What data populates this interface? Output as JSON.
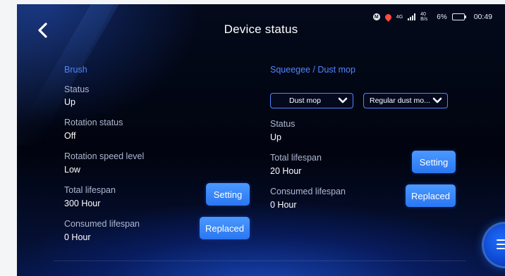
{
  "header": {
    "title": "Device status"
  },
  "status_bar": {
    "network_type": "4G",
    "speed_value": "40",
    "speed_unit": "B/s",
    "battery_percent": "6%",
    "time": "00:49"
  },
  "brush": {
    "section_title": "Brush",
    "status_label": "Status",
    "status_value": "Up",
    "rotation_status_label": "Rotation status",
    "rotation_status_value": "Off",
    "rotation_speed_label": "Rotation speed level",
    "rotation_speed_value": "Low",
    "total_lifespan_label": "Total lifespan",
    "total_lifespan_value": "300 Hour",
    "consumed_lifespan_label": "Consumed lifespan",
    "consumed_lifespan_value": "0 Hour",
    "setting_label": "Setting",
    "replaced_label": "Replaced"
  },
  "squeegee": {
    "section_title": "Squeegee / Dust mop",
    "type_select_value": "Dust mop",
    "mode_select_value": "Regular dust mo...",
    "status_label": "Status",
    "status_value": "Up",
    "total_lifespan_label": "Total lifespan",
    "total_lifespan_value": "20 Hour",
    "consumed_lifespan_label": "Consumed lifespan",
    "consumed_lifespan_value": "0 Hour",
    "setting_label": "Setting",
    "replaced_label": "Replaced"
  },
  "icons": {
    "back": "chevron-left-icon",
    "dropdown": "chevron-down-icon",
    "menu": "menu-icon"
  },
  "colors": {
    "accent": "#4f86ff",
    "button": "#3a87fb",
    "background": "#02071a"
  }
}
